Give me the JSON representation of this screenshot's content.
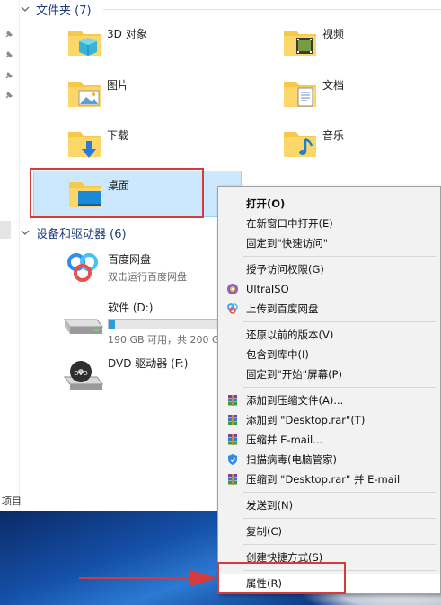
{
  "folders_section": {
    "title": "文件夹 (7)"
  },
  "folders": [
    {
      "name": "3D 对象",
      "icon": "3d-objects-folder-icon"
    },
    {
      "name": "视频",
      "icon": "videos-folder-icon"
    },
    {
      "name": "图片",
      "icon": "pictures-folder-icon"
    },
    {
      "name": "文档",
      "icon": "documents-folder-icon"
    },
    {
      "name": "下载",
      "icon": "downloads-folder-icon"
    },
    {
      "name": "音乐",
      "icon": "music-folder-icon"
    },
    {
      "name": "桌面",
      "icon": "desktop-folder-icon"
    }
  ],
  "devices_section": {
    "title": "设备和驱动器 (6)"
  },
  "devices": [
    {
      "name": "百度网盘",
      "detail": "双击运行百度网盘",
      "icon": "baidu-netdisk-icon"
    },
    {
      "name": "软件 (D:)",
      "detail": "190 GB 可用，共 200 G",
      "used_fraction": 0.05,
      "icon": "hard-drive-icon"
    },
    {
      "name": "DVD 驱动器 (F:)",
      "icon": "dvd-drive-icon"
    }
  ],
  "status_bar": {
    "text": "项目"
  },
  "context_menu": {
    "groups": [
      [
        {
          "label": "打开(O)",
          "bold": true
        },
        {
          "label": "在新窗口中打开(E)"
        },
        {
          "label": "固定到\"快速访问\""
        }
      ],
      [
        {
          "label": "授予访问权限(G)"
        },
        {
          "label": "UltraISO",
          "icon": "ultraiso-icon"
        },
        {
          "label": "上传到百度网盘",
          "icon": "baidu-upload-icon"
        }
      ],
      [
        {
          "label": "还原以前的版本(V)"
        },
        {
          "label": "包含到库中(I)"
        },
        {
          "label": "固定到\"开始\"屏幕(P)"
        }
      ],
      [
        {
          "label": "添加到压缩文件(A)...",
          "icon": "winrar-icon"
        },
        {
          "label": "添加到 \"Desktop.rar\"(T)",
          "icon": "winrar-icon"
        },
        {
          "label": "压缩并 E-mail...",
          "icon": "winrar-icon"
        },
        {
          "label": "扫描病毒(电脑管家)",
          "icon": "tencent-shield-icon"
        },
        {
          "label": "压缩到 \"Desktop.rar\" 并 E-mail",
          "icon": "winrar-icon"
        }
      ],
      [
        {
          "label": "发送到(N)"
        }
      ],
      [
        {
          "label": "复制(C)"
        }
      ],
      [
        {
          "label": "创建快捷方式(S)"
        }
      ],
      [
        {
          "label": "属性(R)"
        }
      ]
    ]
  },
  "colors": {
    "highlight_red": "#d63a3a",
    "selection_blue": "#cce8ff",
    "folder_yellow": "#f6c94b"
  }
}
